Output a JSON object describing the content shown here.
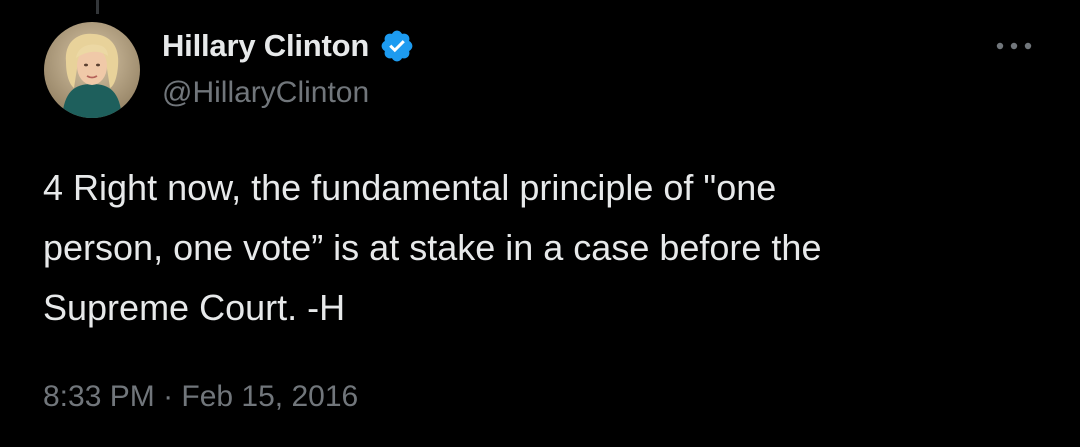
{
  "author": {
    "display_name": "Hillary Clinton",
    "handle": "@HillaryClinton",
    "verified": true,
    "verified_color": "#1d9bf0"
  },
  "tweet": {
    "text": "4 Right now, the fundamental principle of \"one\nperson, one vote” is at stake in a case before the\nSupreme Court. -H"
  },
  "meta": {
    "time": "8:33 PM",
    "separator": " · ",
    "date": "Feb 15, 2016"
  },
  "icons": {
    "more": "more-horizontal-icon",
    "verified": "verified-badge-icon"
  },
  "colors": {
    "background": "#000000",
    "primary_text": "#e7e9ea",
    "secondary_text": "#71767b"
  }
}
